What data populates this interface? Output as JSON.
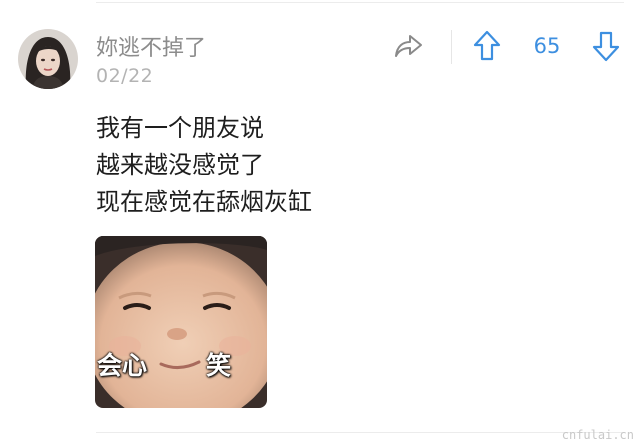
{
  "post": {
    "username": "妳逃不掉了",
    "date": "02/22",
    "votes": "65",
    "content_lines": [
      "我有一个朋友说",
      "越来越没感觉了",
      "现在感觉在舔烟灰缸"
    ]
  },
  "meme": {
    "caption_left": "会心",
    "caption_right": "笑"
  },
  "icons": {
    "share": "share-arrow-icon",
    "upvote": "upvote-arrow-icon",
    "downvote": "downvote-arrow-icon"
  },
  "colors": {
    "accent": "#3d8fe0",
    "username": "#8c8c8c",
    "date": "#b3b3b3",
    "text": "#1e1e1e"
  },
  "watermark": "cnfulai.cn"
}
